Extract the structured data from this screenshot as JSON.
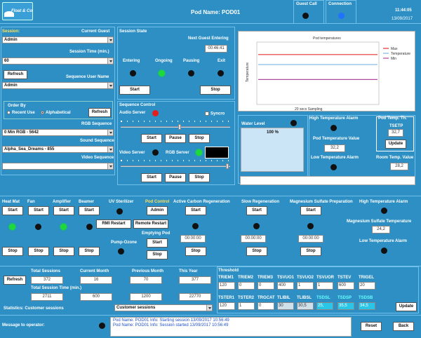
{
  "header": {
    "logo": "Float & Co",
    "title": "Pod Name: POD01",
    "guest_call": "Guest Call",
    "connection": "Connection",
    "time": "11:44:05",
    "date": "13/09/2017"
  },
  "session": {
    "label": "Session:",
    "current_guest_label": "Current Guest",
    "current_guest": "Admin",
    "session_time_label": "Session Time (min.)",
    "session_time": "60",
    "refresh": "Refresh",
    "seq_user_label": "Sequence User Name",
    "seq_user": "Admin",
    "order_by": "Order By",
    "recent_use": "Recent Use",
    "alphabetical": "Alphabetical",
    "refresh2": "Refresh",
    "rgb_seq_label": "RGB Sequence",
    "rgb_seq": "0 Min RGB - 5642",
    "sound_seq_label": "Sound Sequence",
    "sound_seq": "Alpha_Sea_Dreams - 855",
    "video_seq_label": "Video Sequence",
    "video_seq": ""
  },
  "session_state": {
    "title": "Session State",
    "next_guest_label": "Next Guest Entering",
    "next_guest": "00:46:41",
    "states": [
      "Entering",
      "Ongoing",
      "Pausing",
      "Exit"
    ],
    "start": "Start",
    "stop": "Stop"
  },
  "chart_data": {
    "type": "line",
    "title": "Pod temperatures",
    "xlabel": "20 secs Sampling",
    "ylabel": "Temperature",
    "legend": "right",
    "series": [
      {
        "name": "Max",
        "color": "#e53030",
        "value": 40
      },
      {
        "name": "Temperature",
        "color": "#7fb6e6",
        "value": 32
      },
      {
        "name": "Min",
        "color": "#b04aa0",
        "value": 20
      }
    ],
    "ylim": [
      0,
      50
    ]
  },
  "sequence": {
    "title": "Sequence Control",
    "audio_label": "Audio Server",
    "syncro": "Syncro",
    "start": "Start",
    "pause": "Pause",
    "stop": "Stop",
    "video_label": "Video Server",
    "rgb_label": "RGB Server",
    "start2": "Start",
    "pause2": "Pause",
    "stop2": "Stop"
  },
  "water": {
    "label": "Water Level",
    "value": "100 %"
  },
  "temp": {
    "high_alarm": "High Temperature Alarm",
    "pod_temp_value_label": "Pod Temperature Value",
    "pod_temp_value": "32,2",
    "low_alarm": "Low Temperature Alarm",
    "pod_temp_th": "Pod Temp. Th.",
    "tsetp_label": "TSETP",
    "tsetp": "32,7",
    "update": "Update",
    "room_temp_label": "Room Temp. Value",
    "room_temp": "28,2"
  },
  "devices": {
    "heat_mat": "Heat Mat",
    "fan": "Fan",
    "amplifier": "Amplifier",
    "beamer": "Beamer",
    "start": "Start",
    "stop": "Stop",
    "uv_sterilizer": "UV Sterilizer",
    "pod_control": "Pod Control",
    "admin": "Admin",
    "rmi_restart": "RMI Restart",
    "remote_restart": "Remote Restart",
    "emptying_pod": "Emptying Pod",
    "pump_ozone": "Pump-Ozone",
    "acr": "Active Carbon Regeneration",
    "slow_regen": "Slow Regeneration",
    "mag_prep": "Magnesium Sulfate Preparation",
    "timer": "00:00:00",
    "high_temp_alarm": "High Temperature Alarm",
    "mag_temp_label": "Magnesium Sulfate Temperature",
    "mag_temp": "24,2",
    "low_temp_alarm": "Low Temperature Alarm"
  },
  "stats": {
    "refresh": "Refresh",
    "total_sessions": "Total Sessions",
    "current_month": "Current Month",
    "previous_month": "Previous Month",
    "this_year": "This Year",
    "v1": "372",
    "v2": "16",
    "v3": "70",
    "v4": "377",
    "total_time": "Total Session Time (min.)",
    "t1": "2711",
    "t2": "600",
    "t3": "1200",
    "t4": "22770",
    "stat_label": "Statistics: Customer sessions",
    "stat_select": "Customer sessions"
  },
  "threshold": {
    "title": "Threshold",
    "row1": [
      {
        "l": "TRIEM1",
        "v": "120"
      },
      {
        "l": "TRIEM2",
        "v": "0"
      },
      {
        "l": "TRIEM3",
        "v": "0"
      },
      {
        "l": "TSVUO1",
        "v": "400"
      },
      {
        "l": "TSVUO2",
        "v": "1"
      },
      {
        "l": "TSVUOR",
        "v": "1"
      },
      {
        "l": "TSTEV",
        "v": "600"
      },
      {
        "l": "TRIGEL",
        "v": "20"
      }
    ],
    "row2": [
      {
        "l": "TSTER1",
        "v": "120"
      },
      {
        "l": "TSTER2",
        "v": "1"
      },
      {
        "l": "TRGCAT",
        "v": "0"
      },
      {
        "l": "TLIBIL",
        "v": "30"
      },
      {
        "l": "TLIBSL",
        "v": "30,5"
      },
      {
        "l": "TSDSL",
        "v": "25,"
      },
      {
        "l": "TSDSP",
        "v": "35,5"
      },
      {
        "l": "TSDSB",
        "v": "34,5"
      }
    ],
    "update": "Update"
  },
  "messages": {
    "label": "Message to operator:",
    "lines": [
      "Pod Name: POD01 Info: Starting session 13/09/2017 10:56:49",
      "Pod Name: POD01 Info: Session started 13/09/2017 10:56:49"
    ],
    "reset": "Reset",
    "back": "Back"
  }
}
